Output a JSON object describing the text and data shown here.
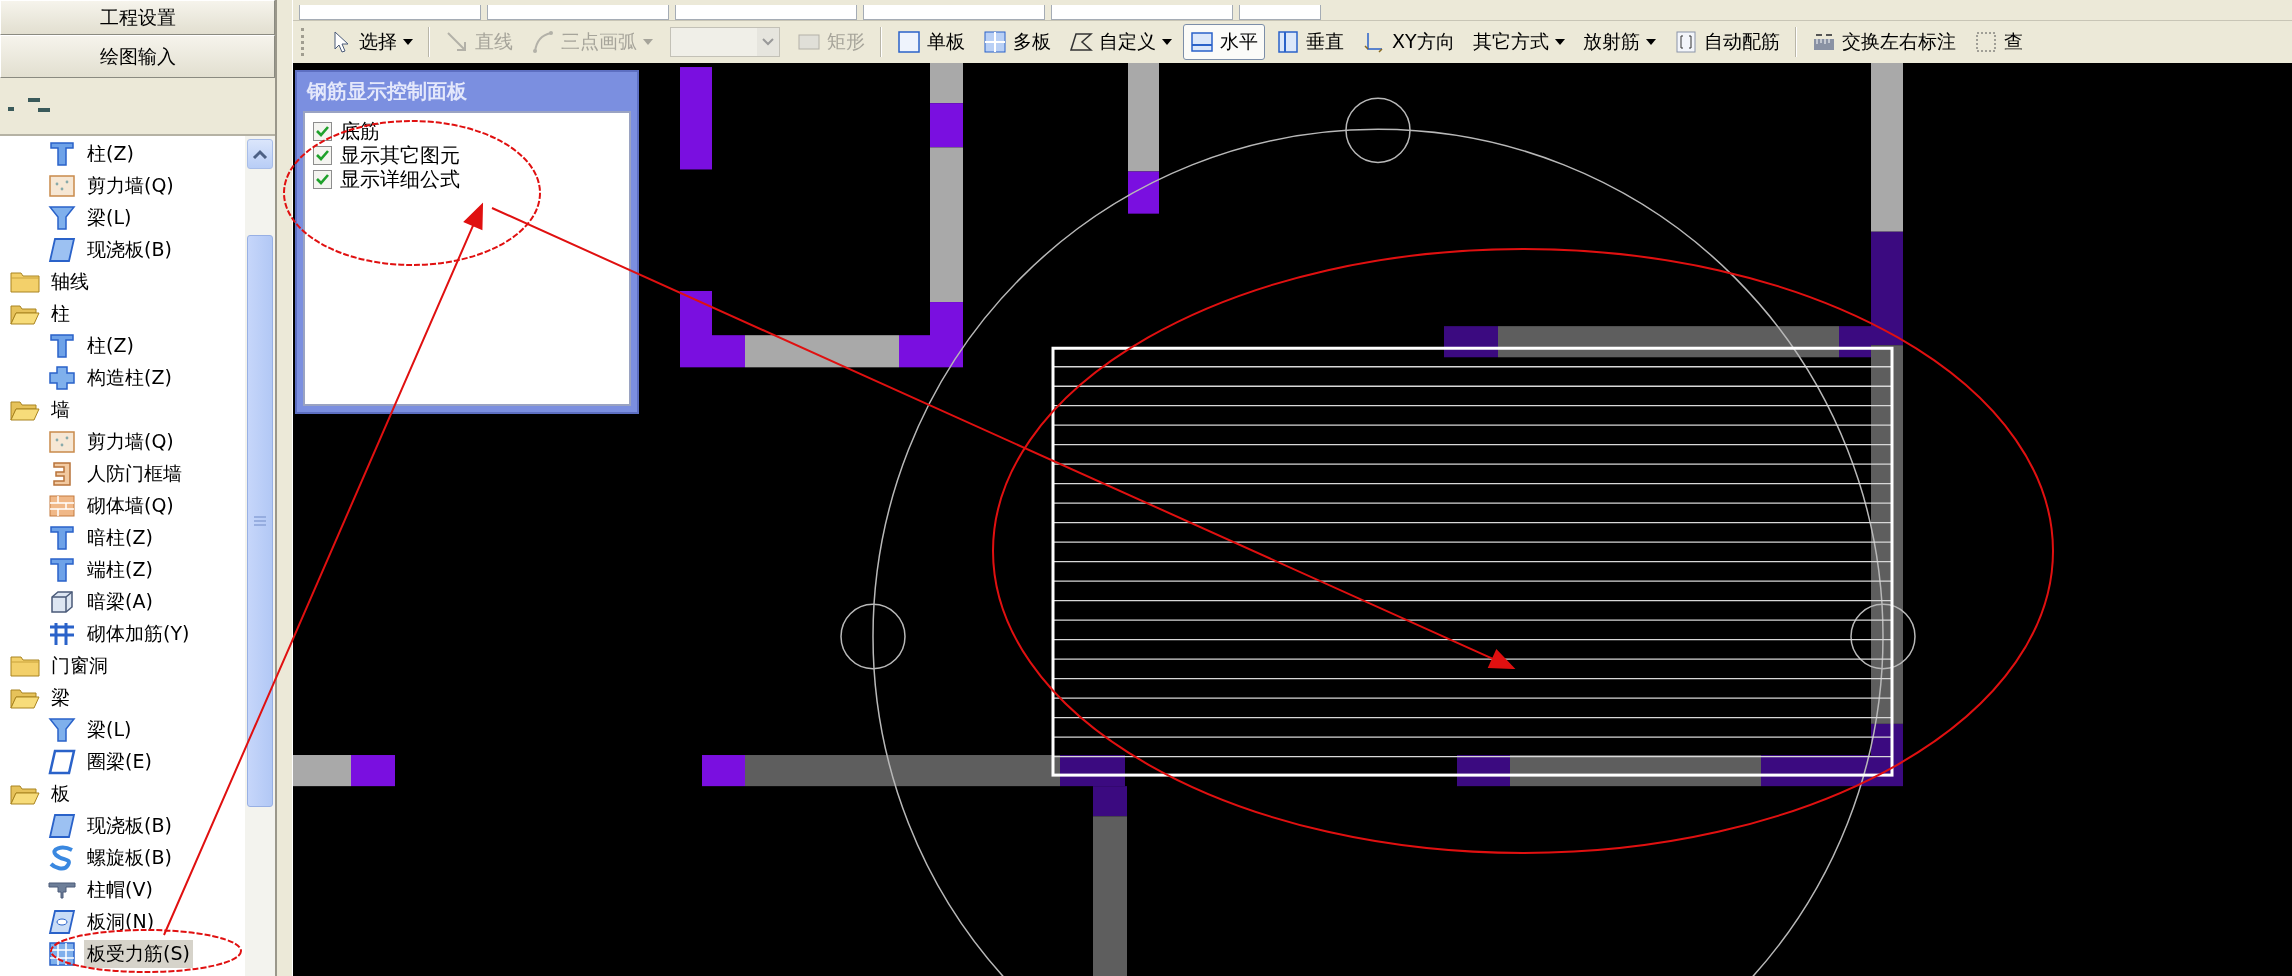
{
  "nav_buttons": [
    {
      "label": "工程设置"
    },
    {
      "label": "绘图输入"
    }
  ],
  "tree": [
    {
      "children": [
        {
          "label": "柱(Z)",
          "kind": "column",
          "selected": false
        },
        {
          "label": "剪力墙(Q)",
          "kind": "shear-wall",
          "selected": false
        },
        {
          "label": "梁(L)",
          "kind": "beam",
          "selected": false
        },
        {
          "label": "现浇板(B)",
          "kind": "slab",
          "selected": false
        }
      ]
    },
    {
      "label": "轴线",
      "expanded": false
    },
    {
      "label": "柱",
      "expanded": true,
      "children": [
        {
          "label": "柱(Z)",
          "kind": "column",
          "selected": false
        },
        {
          "label": "构造柱(Z)",
          "kind": "struct-column",
          "selected": false
        }
      ]
    },
    {
      "label": "墙",
      "expanded": true,
      "children": [
        {
          "label": "剪力墙(Q)",
          "kind": "shear-wall",
          "selected": false
        },
        {
          "label": "人防门框墙",
          "kind": "door-frame-wall",
          "selected": false
        },
        {
          "label": "砌体墙(Q)",
          "kind": "masonry-wall",
          "selected": false
        },
        {
          "label": "暗柱(Z)",
          "kind": "column",
          "selected": false
        },
        {
          "label": "端柱(Z)",
          "kind": "column",
          "selected": false
        },
        {
          "label": "暗梁(A)",
          "kind": "hidden-beam",
          "selected": false
        },
        {
          "label": "砌体加筋(Y)",
          "kind": "masonry-rebar",
          "selected": false
        }
      ]
    },
    {
      "label": "门窗洞",
      "expanded": false
    },
    {
      "label": "梁",
      "expanded": true,
      "children": [
        {
          "label": "梁(L)",
          "kind": "beam",
          "selected": false
        },
        {
          "label": "圈梁(E)",
          "kind": "ring-beam",
          "selected": false
        }
      ]
    },
    {
      "label": "板",
      "expanded": true,
      "children": [
        {
          "label": "现浇板(B)",
          "kind": "slab",
          "selected": false
        },
        {
          "label": "螺旋板(B)",
          "kind": "spiral-slab",
          "selected": false
        },
        {
          "label": "柱帽(V)",
          "kind": "column-cap",
          "selected": false
        },
        {
          "label": "板洞(N)",
          "kind": "slab-hole",
          "selected": false
        },
        {
          "label": "板受力筋(S)",
          "kind": "slab-rebar",
          "selected": true
        }
      ]
    }
  ],
  "toolbar": [
    {
      "kind": "button",
      "label": "选择",
      "dropdown": true,
      "disabled": false,
      "selected": false
    },
    {
      "kind": "separator"
    },
    {
      "kind": "button",
      "label": "直线",
      "dropdown": false,
      "disabled": true,
      "selected": false
    },
    {
      "kind": "button",
      "label": "三点画弧",
      "dropdown": true,
      "disabled": true,
      "selected": false
    },
    {
      "kind": "combo",
      "disabled": true
    },
    {
      "kind": "button",
      "label": "矩形",
      "dropdown": false,
      "disabled": true,
      "selected": false
    },
    {
      "kind": "separator"
    },
    {
      "kind": "button",
      "label": "单板",
      "dropdown": false,
      "disabled": false,
      "selected": false
    },
    {
      "kind": "button",
      "label": "多板",
      "dropdown": false,
      "disabled": false,
      "selected": false
    },
    {
      "kind": "button",
      "label": "自定义",
      "dropdown": true,
      "disabled": false,
      "selected": false
    },
    {
      "kind": "button",
      "label": "水平",
      "dropdown": false,
      "disabled": false,
      "selected": true
    },
    {
      "kind": "button",
      "label": "垂直",
      "dropdown": false,
      "disabled": false,
      "selected": false
    },
    {
      "kind": "button",
      "label": "XY方向",
      "dropdown": false,
      "disabled": false,
      "selected": false
    },
    {
      "kind": "button",
      "label": "其它方式",
      "dropdown": true,
      "disabled": false,
      "selected": false
    },
    {
      "kind": "button",
      "label": "放射筋",
      "dropdown": true,
      "disabled": false,
      "selected": false
    },
    {
      "kind": "button",
      "label": "自动配筋",
      "dropdown": false,
      "disabled": false,
      "selected": false
    },
    {
      "kind": "separator"
    },
    {
      "kind": "button",
      "label": "交换左右标注",
      "dropdown": false,
      "disabled": false,
      "selected": false
    },
    {
      "kind": "button",
      "label": "查",
      "dropdown": false,
      "disabled": false,
      "selected": false
    }
  ],
  "control_panel": {
    "title": "钢筋显示控制面板",
    "options": [
      {
        "label": "底筋",
        "checked": true
      },
      {
        "label": "显示其它图元",
        "checked": true
      },
      {
        "label": "显示详细公式",
        "checked": true
      }
    ]
  }
}
